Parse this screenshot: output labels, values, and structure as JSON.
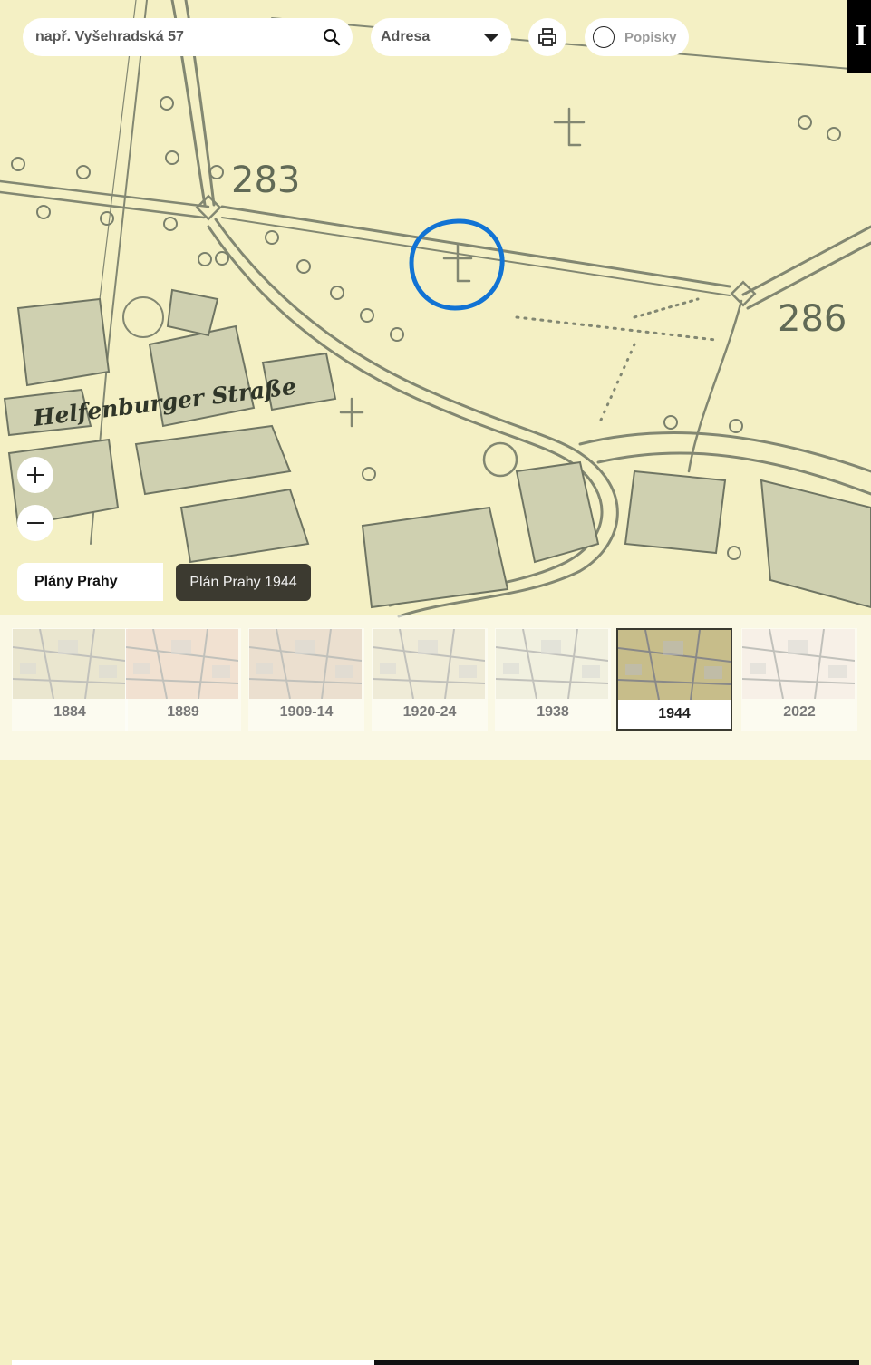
{
  "search": {
    "placeholder": "např. Vyšehradská 57",
    "value": ""
  },
  "search_type": {
    "selected": "Adresa"
  },
  "labels_toggle": {
    "label": "Popisky",
    "checked": false
  },
  "corner_tab": {
    "text": "I"
  },
  "map": {
    "labels": {
      "street": "Helfenburger Straße",
      "point_283": "283",
      "point_286": "286"
    },
    "highlight_color": "#1173d4",
    "paper_color": "#f4f0c4",
    "ink_color": "#707866"
  },
  "layer": {
    "set_name": "Plány Prahy",
    "current_map": "Plán Prahy 1944"
  },
  "timeline": {
    "items": [
      {
        "year": "1884",
        "active": false,
        "tint": "#d9d2b0"
      },
      {
        "year": "1889",
        "active": false,
        "tint": "#e8c9b4"
      },
      {
        "year": "1909-14",
        "active": false,
        "tint": "#dcc4b0"
      },
      {
        "year": "1920-24",
        "active": false,
        "tint": "#e4dcc0"
      },
      {
        "year": "1938",
        "active": false,
        "tint": "#e7e6cf"
      },
      {
        "year": "1944",
        "active": true,
        "tint": "#c7bd8a"
      },
      {
        "year": "2022",
        "active": false,
        "tint": "#f3e6e0"
      }
    ],
    "scroll_position": 0.57
  },
  "icons": [
    "search-icon",
    "chevron-down-icon",
    "print-icon",
    "toggle-circle-icon",
    "plus-icon",
    "minus-icon"
  ]
}
